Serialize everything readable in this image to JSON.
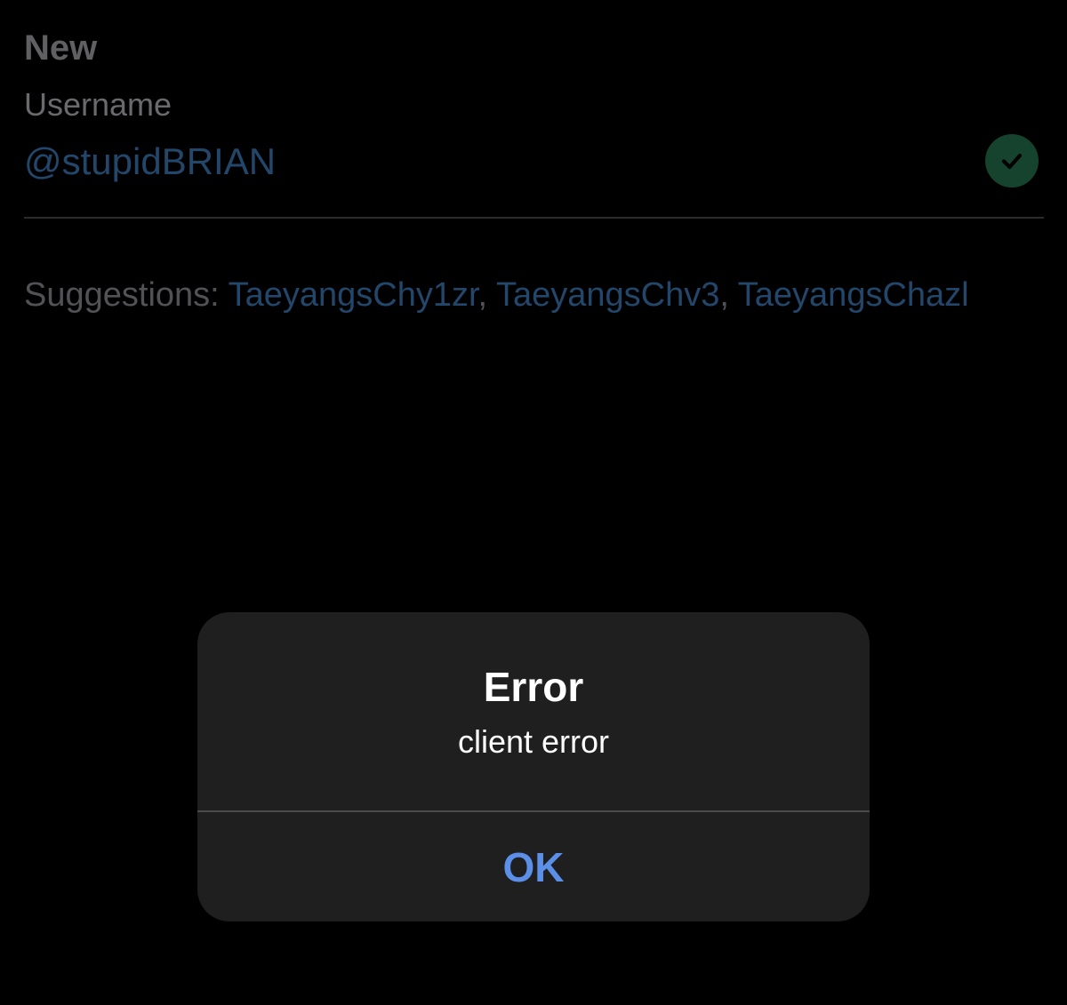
{
  "header": {
    "title": "New"
  },
  "form": {
    "username_label": "Username",
    "username_value": "@stupidBRIAN",
    "valid_icon": "checkmark-circle-icon"
  },
  "suggestions": {
    "prefix": "Suggestions: ",
    "items": [
      "TaeyangsChy1zr",
      "TaeyangsChv3",
      "TaeyangsChazl"
    ],
    "separator": ", "
  },
  "alert": {
    "title": "Error",
    "message": "client error",
    "button_label": "OK"
  },
  "colors": {
    "background": "#000000",
    "link": "#2f5e8f",
    "success": "#1d5a3c",
    "alert_button": "#5b8fe8",
    "alert_background": "#1f1f20"
  }
}
